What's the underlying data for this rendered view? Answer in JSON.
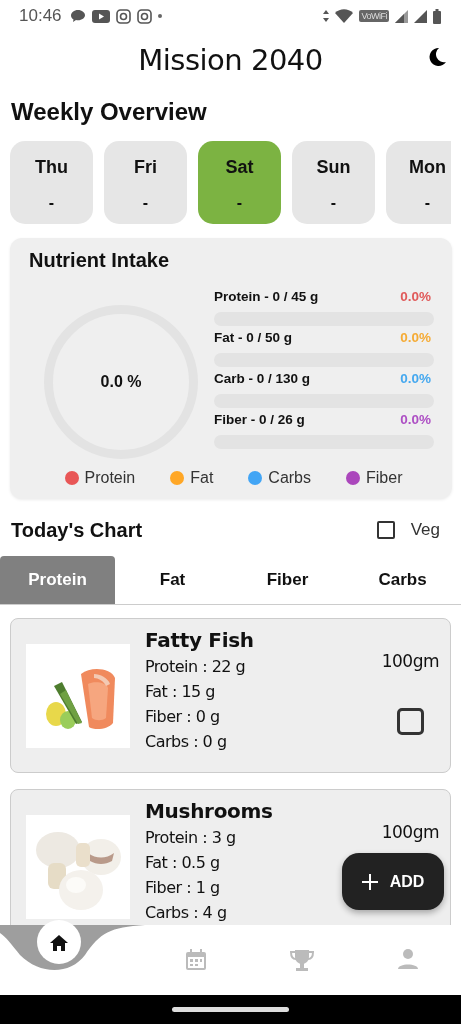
{
  "status_bar": {
    "time": "10:46",
    "network_badge": "VoWiFi"
  },
  "header": {
    "title": "Mission 2040"
  },
  "weekly": {
    "title": "Weekly Overview",
    "days": [
      {
        "label": "Thu",
        "value": "-",
        "selected": false
      },
      {
        "label": "Fri",
        "value": "-",
        "selected": false
      },
      {
        "label": "Sat",
        "value": "-",
        "selected": true
      },
      {
        "label": "Sun",
        "value": "-",
        "selected": false
      },
      {
        "label": "Mon",
        "value": "-",
        "selected": false
      }
    ]
  },
  "nutrients": {
    "title": "Nutrient Intake",
    "total": "0.0 %",
    "items": [
      {
        "label": "Protein - 0 / 45 g",
        "percent": "0.0%",
        "color": "#e05a5a",
        "level": 0
      },
      {
        "label": "Fat - 0 / 50 g",
        "percent": "0.0%",
        "color": "#f5ab35",
        "level": 0
      },
      {
        "label": "Carb - 0 / 130 g",
        "percent": "0.0%",
        "color": "#45a8ef",
        "level": 0
      },
      {
        "label": "Fiber - 0 / 26 g",
        "percent": "0.0%",
        "color": "#ad4fc4",
        "level": 0
      }
    ],
    "legend": [
      {
        "label": "Protein",
        "color": "#e85656"
      },
      {
        "label": "Fat",
        "color": "#ffa726"
      },
      {
        "label": "Carbs",
        "color": "#42a5f5"
      },
      {
        "label": "Fiber",
        "color": "#ab47bc"
      }
    ]
  },
  "chart": {
    "title": "Today's Chart",
    "veg": {
      "label": "Veg",
      "checked": false
    },
    "tabs": [
      {
        "label": "Protein",
        "selected": true
      },
      {
        "label": "Fat",
        "selected": false
      },
      {
        "label": "Fiber",
        "selected": false
      },
      {
        "label": "Carbs",
        "selected": false
      }
    ],
    "foods": [
      {
        "kind": "fish",
        "name": "Fatty Fish",
        "lines": [
          "Protein : 22 g",
          "Fat : 15 g",
          "Fiber : 0 g",
          "Carbs : 0 g"
        ],
        "amount": "100gm",
        "checked": false
      },
      {
        "kind": "mushroom",
        "name": "Mushrooms",
        "lines": [
          "Protein : 3 g",
          "Fat : 0.5 g",
          "Fiber : 1 g",
          "Carbs : 4 g"
        ],
        "amount": "100gm"
      }
    ]
  },
  "add_button": {
    "label": "ADD"
  },
  "nav": {
    "items": [
      {
        "kind": "home",
        "selected": true
      },
      {
        "kind": "calendar",
        "selected": false
      },
      {
        "kind": "trophy",
        "selected": false
      },
      {
        "kind": "person",
        "selected": false
      }
    ]
  }
}
